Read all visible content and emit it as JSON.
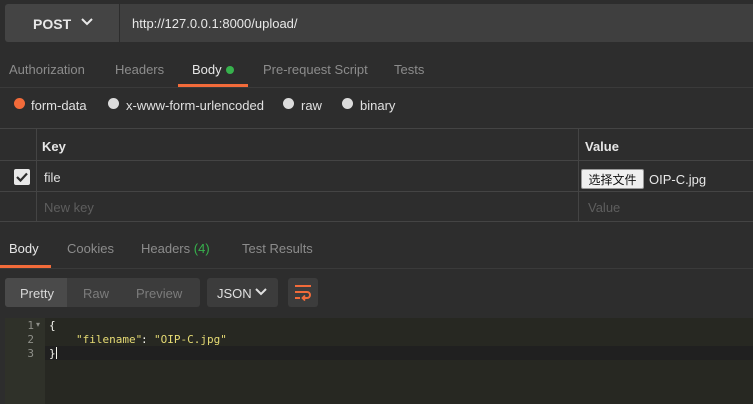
{
  "request": {
    "method": "POST",
    "url": "http://127.0.0.1:8000/upload/"
  },
  "request_tabs": [
    "Authorization",
    "Headers",
    "Body",
    "Pre-request Script",
    "Tests"
  ],
  "body_modes": [
    "form-data",
    "x-www-form-urlencoded",
    "raw",
    "binary"
  ],
  "body_mode_selected": "form-data",
  "kv_table": {
    "headers": {
      "key": "Key",
      "value": "Value"
    },
    "rows": [
      {
        "key": "file",
        "checked": true,
        "choose_button": "选择文件",
        "filename": "OIP-C.jpg"
      }
    ],
    "new_row": {
      "key_placeholder": "New key",
      "value_placeholder": "Value"
    }
  },
  "response_tabs": {
    "body": "Body",
    "cookies": "Cookies",
    "headers": "Headers",
    "headers_count": "(4)",
    "test_results": "Test Results"
  },
  "view_modes": [
    "Pretty",
    "Raw",
    "Preview"
  ],
  "format": "JSON",
  "code": {
    "line_numbers": [
      "1",
      "2",
      "3"
    ],
    "open_brace": "{",
    "key": "\"filename\"",
    "colon": ":",
    "value": "\"OIP-C.jpg\"",
    "close_brace": "}"
  },
  "colors": {
    "accent": "#f26b3a",
    "status_green": "#37b24d",
    "background": "#2d2d2d",
    "editor_bg": "#272822",
    "json_string": "#e6db74"
  }
}
